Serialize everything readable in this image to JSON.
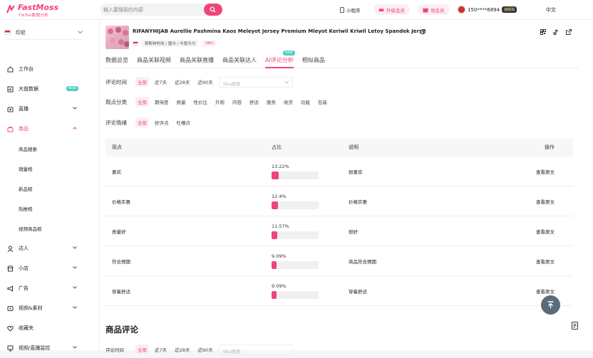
{
  "header": {
    "logo_name": "FastMoss",
    "logo_sub": "TikTok数据分析",
    "search_placeholder": "输入要搜索的内容",
    "mini_program": "小程序",
    "upgrade": "升级会员",
    "vip": "领会员",
    "user_phone": "150****6894",
    "user_badge": "旗舰版",
    "language": "中文"
  },
  "sidebar": {
    "region": "印尼",
    "items": [
      {
        "label": "工作台",
        "icon": "home-icon"
      },
      {
        "label": "大盘数据",
        "icon": "chart-icon",
        "tag": "NEW"
      },
      {
        "label": "直播",
        "icon": "live-icon"
      },
      {
        "label": "商品",
        "icon": "bag-icon"
      },
      {
        "label": "达人",
        "icon": "user-icon"
      },
      {
        "label": "小店",
        "icon": "store-icon"
      },
      {
        "label": "广告",
        "icon": "megaphone-icon"
      },
      {
        "label": "视频&素材",
        "icon": "video-icon"
      },
      {
        "label": "收藏夹",
        "icon": "heart-icon"
      },
      {
        "label": "视频/直播监控",
        "icon": "monitor-icon"
      }
    ],
    "sub_items": [
      "商品搜索",
      "销量榜",
      "新品榜",
      "热推榜",
      "视频商品榜"
    ]
  },
  "product": {
    "title": "RIFANYHIJAB Aurellie Pashmina Kaos Meleyot Jersey Premium Mleyot Keriwil Kriwil Letoy Spandek Jersy",
    "category": "穆斯林时尚 / 围巾 / 半裁头巾",
    "sku_label": "SKU"
  },
  "tabs": [
    {
      "label": "数据总览"
    },
    {
      "label": "商品关联视频"
    },
    {
      "label": "商品关联直播"
    },
    {
      "label": "商品关联达人"
    },
    {
      "label": "AI评论分析",
      "tag": "NEW"
    },
    {
      "label": "相似商品"
    }
  ],
  "filters": {
    "time_label": "评论时间",
    "time_options": [
      "全部",
      "近7天",
      "近28天",
      "近90天"
    ],
    "sku_placeholder": "Sku搜索",
    "category_label": "观点分类",
    "category_options": [
      "全部",
      "期待度",
      "质量",
      "性价比",
      "外观",
      "内容",
      "舒适",
      "服务",
      "收货",
      "功能",
      "包装"
    ],
    "sentiment_label": "评论情绪",
    "sentiment_options": [
      "全部",
      "好评点",
      "吐槽点"
    ]
  },
  "table": {
    "headers": [
      "观点",
      "占比",
      "说明",
      "操作"
    ],
    "rows": [
      {
        "point": "喜欢",
        "percent": "13.22%",
        "value": 0.1322,
        "desc": "很喜欢",
        "action": "查看原文"
      },
      {
        "point": "价格实惠",
        "percent": "12.4%",
        "value": 0.124,
        "desc": "价格实惠",
        "action": "查看原文"
      },
      {
        "point": "质量好",
        "percent": "11.57%",
        "value": 0.1157,
        "desc": "很好",
        "action": "查看原文"
      },
      {
        "point": "符合预期",
        "percent": "9.09%",
        "value": 0.0909,
        "desc": "商品符合预期",
        "action": "查看原文"
      },
      {
        "point": "穿着舒适",
        "percent": "9.09%",
        "value": 0.0909,
        "desc": "穿着舒适",
        "action": "查看原文"
      }
    ]
  },
  "reviews": {
    "title": "商品评论",
    "time_label": "评论时间",
    "time_options": [
      "全部",
      "近7天",
      "近28天",
      "近90天"
    ],
    "sku_placeholder": "Sku搜索"
  },
  "colors": {
    "accent": "#f0457a",
    "new_tag": "#4ecdc4"
  }
}
